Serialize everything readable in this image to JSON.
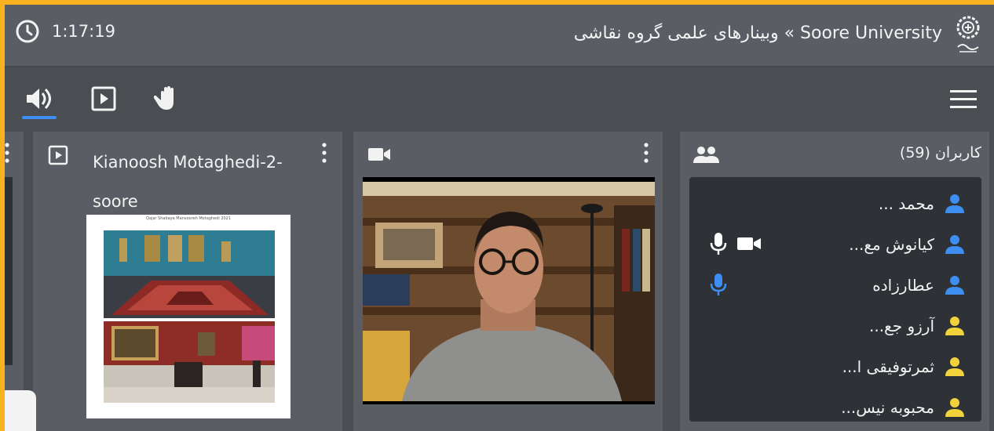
{
  "header": {
    "time": "1:17:19",
    "title": "Soore University » وبینارهای علمی گروه نقاشی"
  },
  "toolbar": {
    "icons": [
      "audio-icon",
      "presentation-icon",
      "raise-hand-icon",
      "menu-icon"
    ],
    "active_color": "#3d8ef0"
  },
  "slides_panel": {
    "title": "Kianoosh Motaghedi-2-soore",
    "slide_caption": "Qajar Shabaye Mansooreh Motaghedi 2021"
  },
  "users_panel": {
    "title": "کاربران (59)",
    "users": [
      {
        "name": "محمد ...",
        "color": "#3d8ef0",
        "mic": false,
        "cam": false
      },
      {
        "name": "کیانوش مع...",
        "color": "#3d8ef0",
        "mic": true,
        "mic_color": "#ffffff",
        "cam": true
      },
      {
        "name": "عطارزاده",
        "color": "#3d8ef0",
        "mic": true,
        "mic_color": "#3d8ef0",
        "cam": false
      },
      {
        "name": "آرزو جع...",
        "color": "#f2d23b",
        "mic": false,
        "cam": false
      },
      {
        "name": "ثمرتوفیقی ا...",
        "color": "#f2d23b",
        "mic": false,
        "cam": false
      },
      {
        "name": "محبوبه نیس...",
        "color": "#f2d23b",
        "mic": false,
        "cam": false
      }
    ]
  }
}
